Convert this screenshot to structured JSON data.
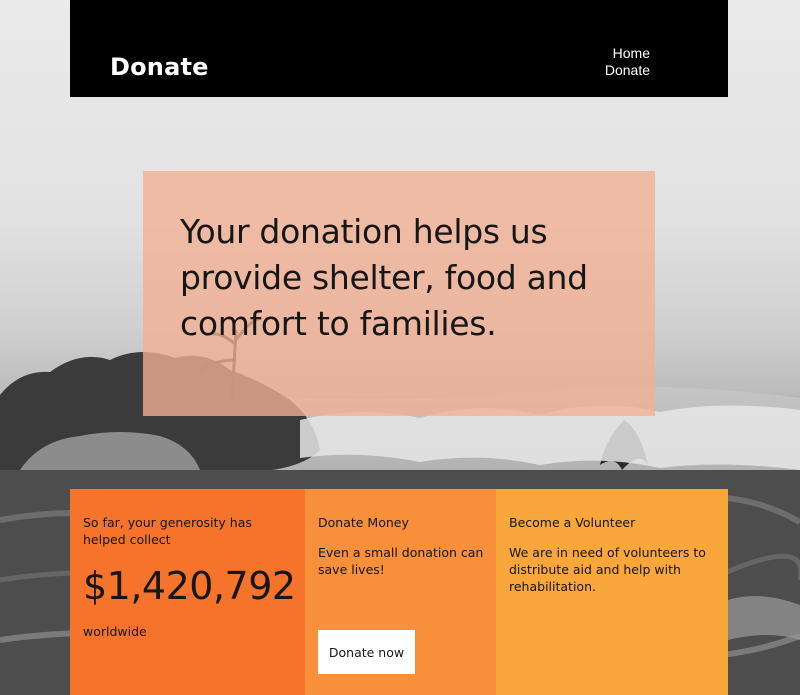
{
  "header": {
    "brand": "Donate",
    "nav": [
      {
        "label": "Home"
      },
      {
        "label": "Donate"
      }
    ]
  },
  "hero": {
    "headline": "Your donation helps us provide shelter, food and comfort to families."
  },
  "cards": {
    "progress": {
      "heading": "So far, your generosity has helped collect",
      "amount": "$1,420,792",
      "footnote": "worldwide"
    },
    "money": {
      "heading": "Donate Money",
      "body": "Even a small donation can save lives!",
      "button_label": "Donate now"
    },
    "volunteer": {
      "heading": "Become a Volunteer",
      "body": "We are in need of volunteers to distribute aid and help with rehabilitation."
    }
  },
  "colors": {
    "header_bg": "#000000",
    "hero_overlay": "#f4b094",
    "card_progress": "#f5732b",
    "card_money": "#f88f3b",
    "card_volunteer": "#f9a63b"
  }
}
